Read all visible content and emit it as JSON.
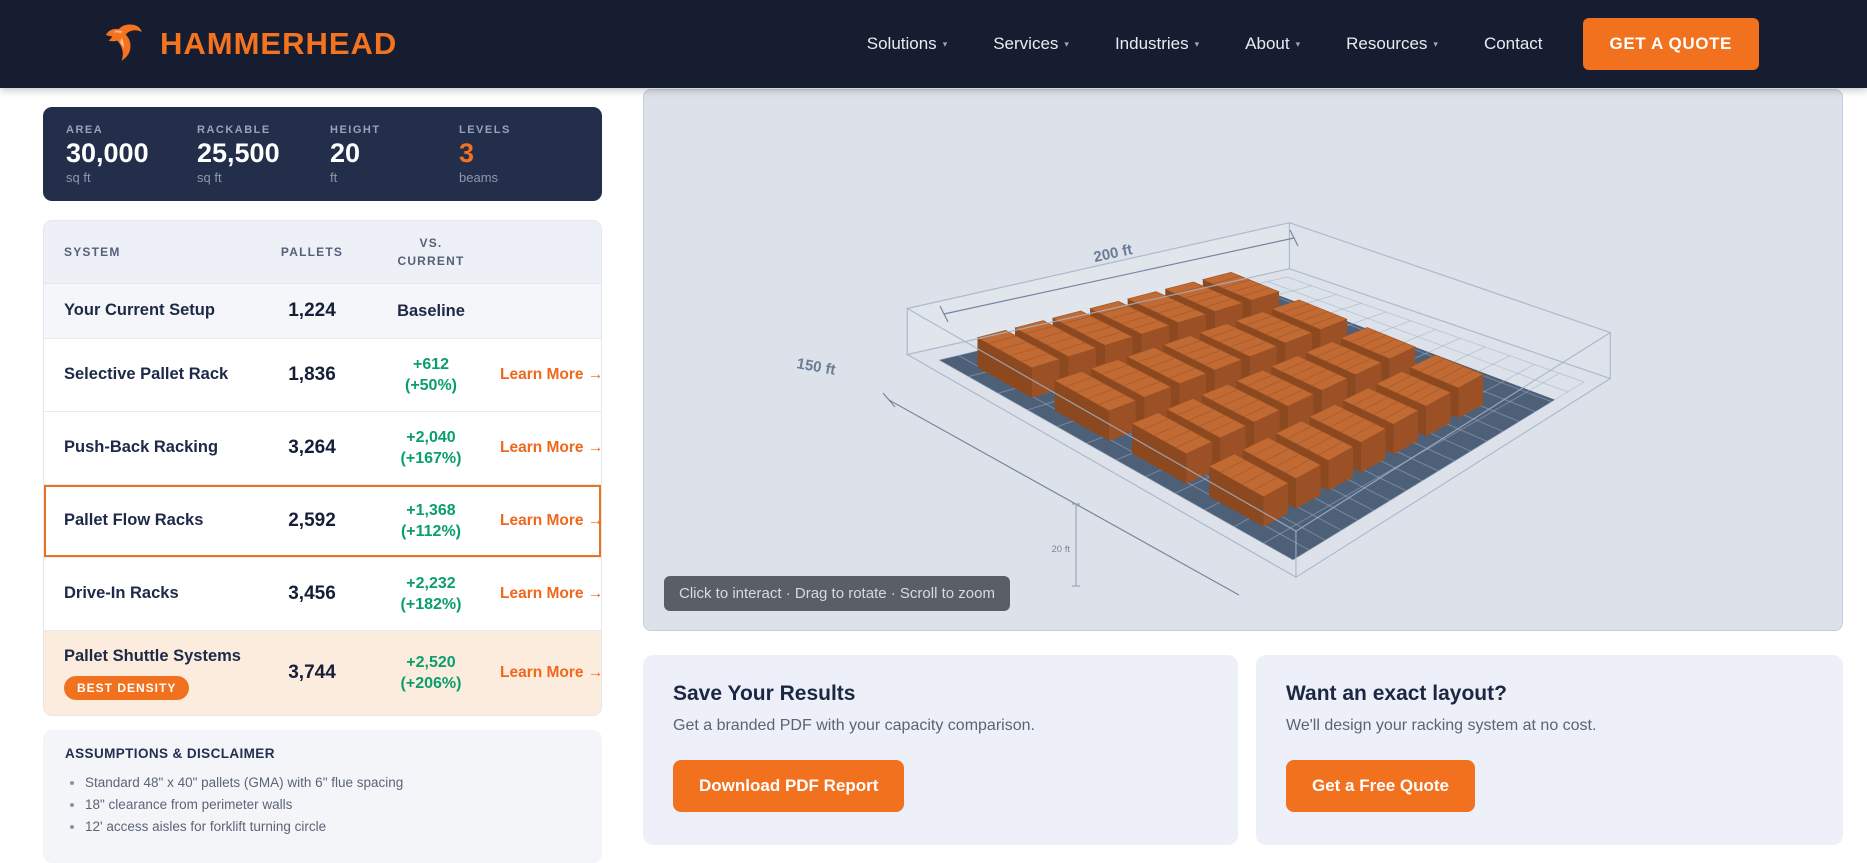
{
  "nav": {
    "brand": "HAMMERHEAD",
    "items": [
      {
        "label": "Solutions",
        "has_dropdown": true
      },
      {
        "label": "Services",
        "has_dropdown": true
      },
      {
        "label": "Industries",
        "has_dropdown": true
      },
      {
        "label": "About",
        "has_dropdown": true
      },
      {
        "label": "Resources",
        "has_dropdown": true
      },
      {
        "label": "Contact",
        "has_dropdown": false
      }
    ],
    "cta": "GET A QUOTE"
  },
  "stats": [
    {
      "label": "AREA",
      "value": "30,000",
      "unit": "sq ft",
      "highlight": false
    },
    {
      "label": "RACKABLE",
      "value": "25,500",
      "unit": "sq ft",
      "highlight": false
    },
    {
      "label": "HEIGHT",
      "value": "20",
      "unit": "ft",
      "highlight": false
    },
    {
      "label": "LEVELS",
      "value": "3",
      "unit": "beams",
      "highlight": true
    }
  ],
  "table": {
    "headers": [
      "SYSTEM",
      "PALLETS",
      "VS. CURRENT"
    ],
    "rows": [
      {
        "system": "Your Current Setup",
        "pallets": "1,224",
        "vs": "Baseline",
        "baseline": true
      },
      {
        "system": "Selective Pallet Rack",
        "pallets": "1,836",
        "delta": "+612",
        "pct": "(+50%)",
        "link": "Learn More →"
      },
      {
        "system": "Push-Back Racking",
        "pallets": "3,264",
        "delta": "+2,040",
        "pct": "(+167%)",
        "link": "Learn More →"
      },
      {
        "system": "Pallet Flow Racks",
        "pallets": "2,592",
        "delta": "+1,368",
        "pct": "(+112%)",
        "link": "Learn More →",
        "selected": true
      },
      {
        "system": "Drive-In Racks",
        "pallets": "3,456",
        "delta": "+2,232",
        "pct": "(+182%)",
        "link": "Learn More →"
      },
      {
        "system": "Pallet Shuttle Systems",
        "pallets": "3,744",
        "delta": "+2,520",
        "pct": "(+206%)",
        "link": "Learn More →",
        "badge": "BEST DENSITY",
        "best": true
      }
    ]
  },
  "assumptions": {
    "title": "ASSUMPTIONS & DISCLAIMER",
    "bullets": [
      "Standard 48\" x 40\" pallets (GMA) with 6\" flue spacing",
      "18\" clearance from perimeter walls",
      "12' access aisles for forklift turning circle"
    ]
  },
  "viz": {
    "dim_width": "200 ft",
    "dim_depth": "150 ft",
    "dim_height": "20 ft",
    "hint": "Click to interact · Drag to rotate · Scroll to zoom"
  },
  "cards": [
    {
      "title": "Save Your Results",
      "subtitle": "Get a branded PDF with your capacity comparison.",
      "button": "Download PDF Report"
    },
    {
      "title": "Want an exact layout?",
      "subtitle": "We'll design your racking system at no cost.",
      "button": "Get a Free Quote"
    }
  ],
  "colors": {
    "accent": "#f2711f",
    "navy": "#171d30",
    "green": "#0a9e6e",
    "slate_floor": "#4d6078"
  }
}
